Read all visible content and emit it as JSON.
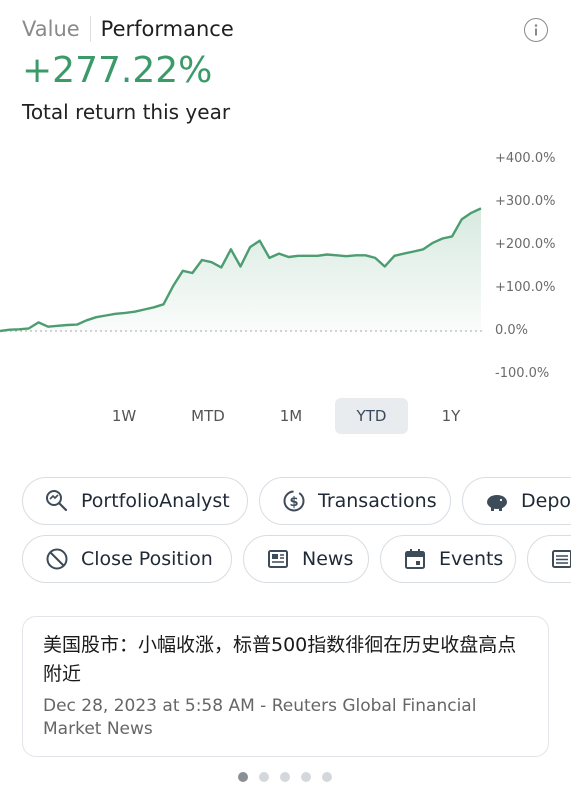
{
  "header": {
    "tab_value": "Value",
    "tab_performance": "Performance",
    "info_icon": "info-icon"
  },
  "summary": {
    "value": "+277.22%",
    "caption": "Total return this year",
    "accent_color": "#3a9a68"
  },
  "chart_data": {
    "type": "area",
    "y_tick_labels": [
      "+400.0%",
      "+300.0%",
      "+200.0%",
      "+100.0%",
      "0.0%",
      "-100.0%"
    ],
    "ylim": [
      -100,
      400
    ],
    "baseline": 0,
    "line_color": "#4c9d71",
    "x": [
      0,
      2,
      4,
      6,
      8,
      10,
      12,
      14,
      16,
      18,
      20,
      22,
      24,
      26,
      28,
      30,
      32,
      34,
      36,
      38,
      40,
      42,
      44,
      46,
      48,
      50,
      52,
      54,
      56,
      58,
      60,
      62,
      64,
      66,
      68,
      70,
      72,
      74,
      76,
      78,
      80,
      82,
      84,
      86,
      88,
      90,
      92,
      94,
      96,
      98,
      100
    ],
    "values": [
      0,
      3,
      4,
      6,
      20,
      10,
      12,
      14,
      15,
      25,
      32,
      36,
      40,
      42,
      45,
      50,
      55,
      62,
      105,
      140,
      135,
      165,
      160,
      148,
      190,
      150,
      195,
      210,
      170,
      180,
      172,
      175,
      175,
      175,
      178,
      176,
      174,
      176,
      176,
      170,
      150,
      175,
      180,
      185,
      190,
      205,
      215,
      220,
      260,
      275,
      285
    ]
  },
  "ranges": {
    "items": [
      "1W",
      "MTD",
      "1M",
      "YTD",
      "1Y"
    ],
    "selected": "YTD"
  },
  "actions": {
    "portfolio_analyst": "PortfolioAnalyst",
    "transactions": "Transactions",
    "deposits": "Depo",
    "close_position": "Close Position",
    "news": "News",
    "events": "Events"
  },
  "news": {
    "title": "美国股市：小幅收涨，标普500指数徘徊在历史收盘高点附近",
    "meta": "Dec 28, 2023 at 5:58 AM - Reuters Global Financial Market News"
  },
  "pager": {
    "count": 5,
    "active_index": 0
  }
}
